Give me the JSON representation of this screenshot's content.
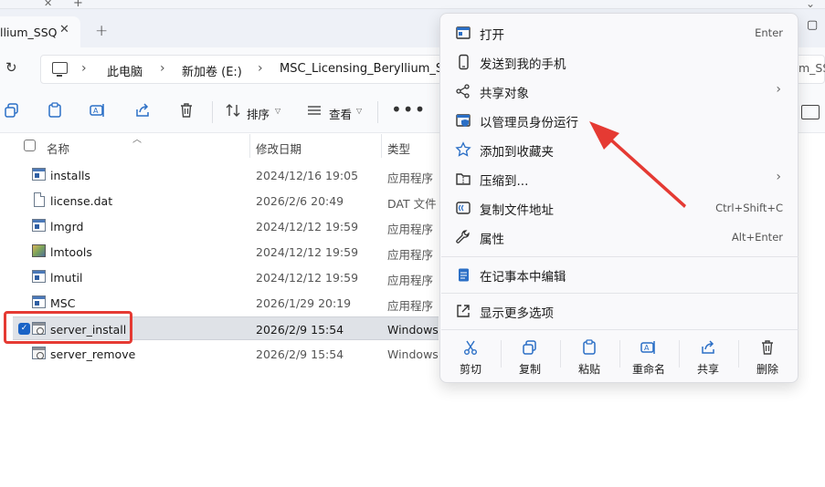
{
  "tab": {
    "title": "llium_SSQ",
    "close": "✕",
    "new": "+"
  },
  "address": {
    "refresh": "↻",
    "crumbs": [
      "此电脑",
      "新加卷 (E:)",
      "MSC_Licensing_Beryllium_SS"
    ],
    "overflow_right": "m_SS("
  },
  "toolbar": {
    "sort": "排序",
    "view": "查看",
    "more": "•••"
  },
  "columns": {
    "name": "名称",
    "date": "修改日期",
    "type": "类型"
  },
  "files": [
    {
      "name": "installs",
      "date": "2024/12/16 19:05",
      "type": "应用程序",
      "icon": "exe-icon"
    },
    {
      "name": "license.dat",
      "date": "2026/2/6 20:49",
      "type": "DAT 文件",
      "icon": "document-icon"
    },
    {
      "name": "lmgrd",
      "date": "2024/12/12 19:59",
      "type": "应用程序",
      "icon": "exe-icon"
    },
    {
      "name": "lmtools",
      "date": "2024/12/12 19:59",
      "type": "应用程序",
      "icon": "lmtools-icon"
    },
    {
      "name": "lmutil",
      "date": "2024/12/12 19:59",
      "type": "应用程序",
      "icon": "exe-icon"
    },
    {
      "name": "MSC",
      "date": "2026/1/29 20:19",
      "type": "应用程序",
      "icon": "exe-icon"
    },
    {
      "name": "server_install",
      "date": "2026/2/9 15:54",
      "type": "Windows",
      "icon": "batch-file-icon",
      "selected": true
    },
    {
      "name": "server_remove",
      "date": "2026/2/9 15:54",
      "type": "Windows",
      "icon": "batch-file-icon"
    }
  ],
  "context_menu": {
    "items": [
      {
        "label": "打开",
        "shortcut": "Enter"
      },
      {
        "label": "发送到我的手机",
        "shortcut": ""
      },
      {
        "label": "共享对象",
        "shortcut": ""
      },
      {
        "label": "以管理员身份运行",
        "shortcut": ""
      },
      {
        "label": "添加到收藏夹",
        "shortcut": ""
      },
      {
        "label": "压缩到...",
        "shortcut": ""
      },
      {
        "label": "复制文件地址",
        "shortcut": "Ctrl+Shift+C"
      },
      {
        "label": "属性",
        "shortcut": "Alt+Enter"
      },
      {
        "label": "在记事本中编辑",
        "shortcut": ""
      },
      {
        "label": "显示更多选项",
        "shortcut": ""
      }
    ],
    "quick_actions": [
      "剪切",
      "复制",
      "粘贴",
      "重命名",
      "共享",
      "删除"
    ]
  },
  "colors": {
    "accent": "#2b6fc6",
    "highlight_box": "#e53a33",
    "arrow": "#e53a33",
    "selected_row": "#dfe2e7"
  }
}
